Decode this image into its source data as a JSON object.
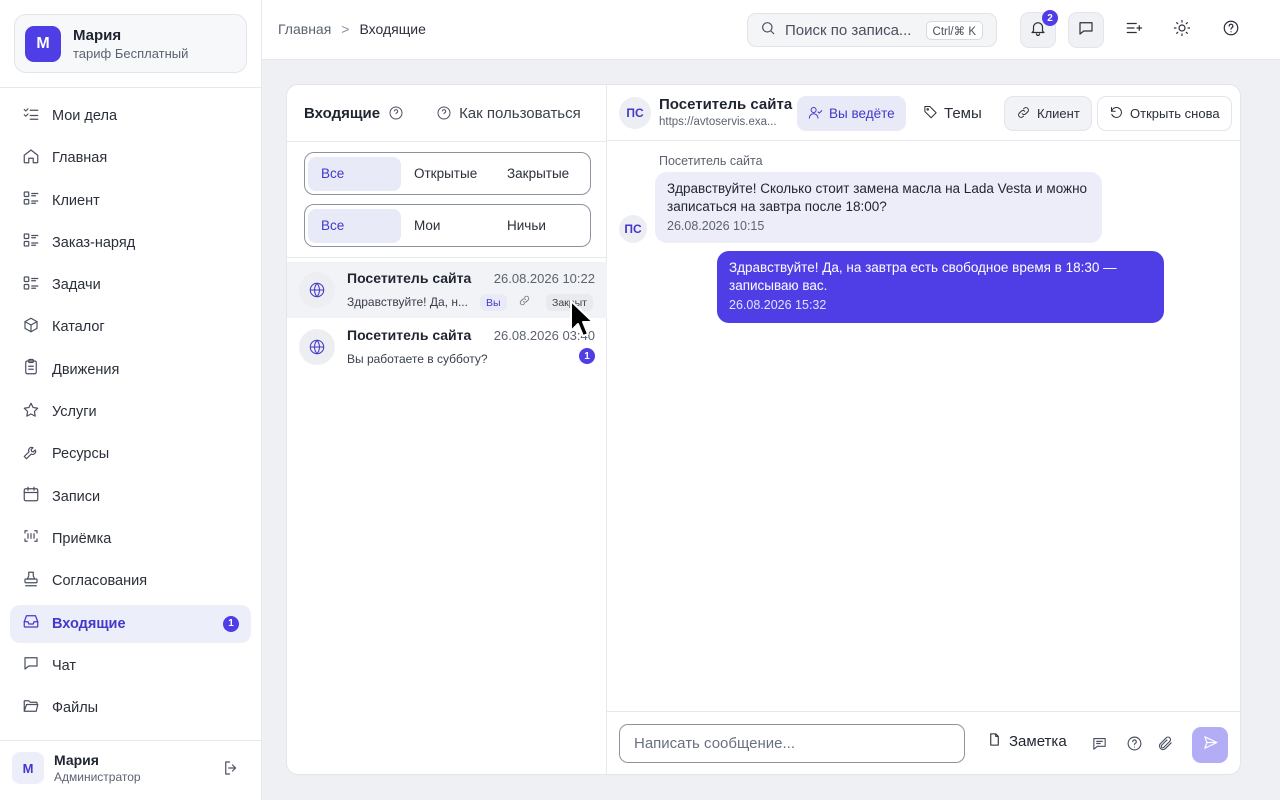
{
  "workspace": {
    "initial": "М",
    "name": "Мария",
    "plan": "тариф Бесплатный"
  },
  "nav": {
    "items": [
      {
        "label": "Мои дела",
        "icon": "checklist-icon"
      },
      {
        "label": "Главная",
        "icon": "home-icon"
      },
      {
        "label": "Клиент",
        "icon": "list-icon"
      },
      {
        "label": "Заказ-наряд",
        "icon": "list-icon"
      },
      {
        "label": "Задачи",
        "icon": "list-icon"
      },
      {
        "label": "Каталог",
        "icon": "box-icon"
      },
      {
        "label": "Движения",
        "icon": "clipboard-icon"
      },
      {
        "label": "Услуги",
        "icon": "star-icon"
      },
      {
        "label": "Ресурсы",
        "icon": "wrench-icon"
      },
      {
        "label": "Записи",
        "icon": "calendar-icon"
      },
      {
        "label": "Приёмка",
        "icon": "scan-icon"
      },
      {
        "label": "Согласования",
        "icon": "stamp-icon"
      },
      {
        "label": "Входящие",
        "icon": "inbox-icon",
        "badge": "1",
        "active": true
      },
      {
        "label": "Чат",
        "icon": "chat-icon"
      },
      {
        "label": "Файлы",
        "icon": "folder-icon"
      }
    ]
  },
  "user": {
    "initial": "М",
    "name": "Мария",
    "role": "Администратор"
  },
  "breadcrumb": {
    "root": "Главная",
    "separator": ">",
    "current": "Входящие"
  },
  "search": {
    "placeholder": "Поиск по записям...",
    "text": "Поиск по записа...",
    "shortcut": "Ctrl/⌘ K"
  },
  "topbar": {
    "notifications_count": "2"
  },
  "inbox": {
    "title": "Входящие",
    "howto": "Как пользоваться",
    "status_filter": [
      "Все",
      "Открытые",
      "Закрытые"
    ],
    "owner_filter": [
      "Все",
      "Мои",
      "Ничьи"
    ],
    "conversations": [
      {
        "name": "Посетитель сайта",
        "time": "26.08.2026 10:22",
        "preview": "Здравствуйте! Да, н...",
        "you_pill": "Вы",
        "status_pill": "Закрыт",
        "selected": true
      },
      {
        "name": "Посетитель сайта",
        "time": "26.08.2026 03:40",
        "preview": "Вы работаете в субботу?",
        "unread": "1"
      }
    ]
  },
  "chat": {
    "avatar": "ПС",
    "name": "Посетитель сайта",
    "url": "https://avtoservis.exa...",
    "you_lead": "Вы ведёте",
    "topics": "Темы",
    "client": "Клиент",
    "reopen": "Открыть снова",
    "messages": [
      {
        "direction": "in",
        "sender": "Посетитель сайта",
        "text": "Здравствуйте! Сколько стоит замена масла на Lada Vesta и можно записаться на завтра после 18:00?",
        "time": "26.08.2026 10:15"
      },
      {
        "direction": "out",
        "text": "Здравствуйте! Да, на завтра есть свободное время в 18:30 — записываю вас.",
        "time": "26.08.2026 15:32"
      }
    ],
    "composer": {
      "placeholder": "Написать сообщение...",
      "note_label": "Заметка"
    }
  },
  "colors": {
    "accent": "#4f3ee6",
    "accent_text": "#4338ca",
    "active_bg": "#eceefa"
  }
}
